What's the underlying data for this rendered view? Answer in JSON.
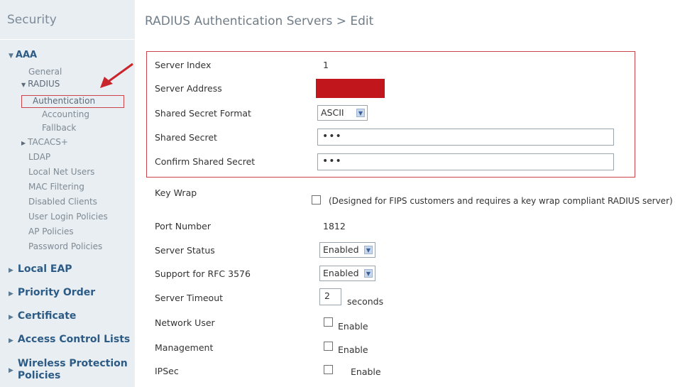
{
  "sidebar": {
    "title": "Security",
    "aaa_label": "AAA",
    "aaa_items": {
      "general": "General",
      "radius": "RADIUS",
      "authentication": "Authentication",
      "accounting": "Accounting",
      "fallback": "Fallback",
      "tacacs": "TACACS+",
      "ldap": "LDAP",
      "local_net_users": "Local Net Users",
      "mac_filtering": "MAC Filtering",
      "disabled_clients": "Disabled Clients",
      "user_login_policies": "User Login Policies",
      "ap_policies": "AP Policies",
      "password_policies": "Password Policies"
    },
    "sections": {
      "local_eap": "Local EAP",
      "priority_order": "Priority Order",
      "certificate": "Certificate",
      "access_control_lists": "Access Control Lists",
      "wireless_protection_1": "Wireless Protection",
      "wireless_protection_2": "Policies"
    }
  },
  "page": {
    "title": "RADIUS Authentication Servers > Edit"
  },
  "form": {
    "server_index_label": "Server Index",
    "server_index_value": "1",
    "server_address_label": "Server Address",
    "shared_secret_format_label": "Shared Secret Format",
    "shared_secret_format_value": "ASCII",
    "shared_secret_label": "Shared Secret",
    "shared_secret_value": "•••",
    "confirm_shared_secret_label": "Confirm Shared Secret",
    "confirm_shared_secret_value": "•••",
    "key_wrap_label": "Key Wrap",
    "key_wrap_note": "(Designed for FIPS customers and requires a key wrap compliant RADIUS server)",
    "port_number_label": "Port Number",
    "port_number_value": "1812",
    "server_status_label": "Server Status",
    "server_status_value": "Enabled",
    "rfc3576_label": "Support for RFC 3576",
    "rfc3576_value": "Enabled",
    "server_timeout_label": "Server Timeout",
    "server_timeout_value": "2",
    "server_timeout_unit": "seconds",
    "network_user_label": "Network User",
    "network_user_enable": "Enable",
    "management_label": "Management",
    "management_enable": "Enable",
    "ipsec_label": "IPSec",
    "ipsec_enable": "Enable"
  },
  "colors": {
    "highlight_border": "#c9444b",
    "redacted_block": "#c0161c",
    "nav_link": "#2c5b86"
  }
}
